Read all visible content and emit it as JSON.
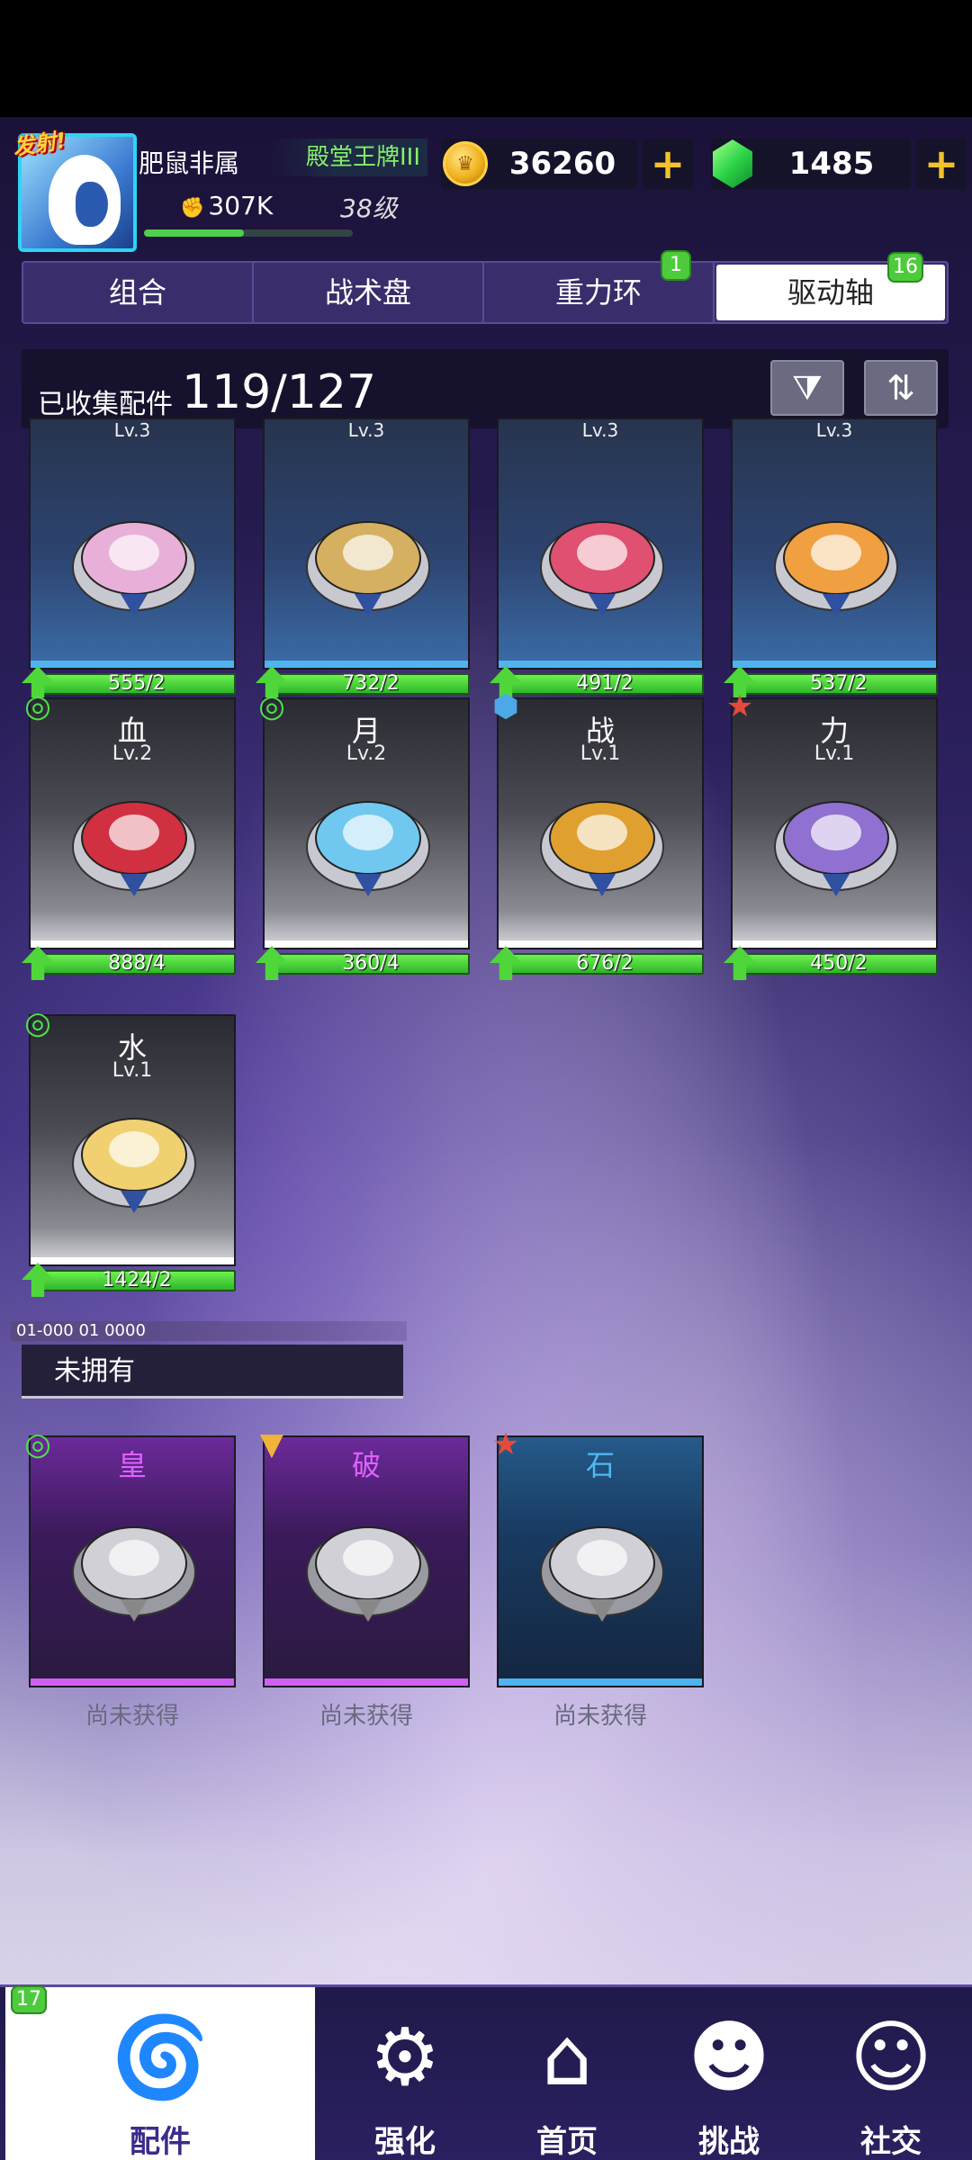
{
  "header": {
    "fire_badge": "发射!",
    "player_name": "肥鼠非属",
    "rank": "殿堂王牌III",
    "power": "307K",
    "level": "38级",
    "xp_fraction": 0.48,
    "gold": "36260",
    "gems": "1485"
  },
  "tabs": [
    {
      "label": "组合",
      "badge": ""
    },
    {
      "label": "战术盘",
      "badge": ""
    },
    {
      "label": "重力环",
      "badge": "1"
    },
    {
      "label": "驱动轴",
      "badge": "16"
    }
  ],
  "active_tab": "驱动轴",
  "collection": {
    "label": "已收集配件",
    "count": "119/127"
  },
  "owned_parts": [
    {
      "name": "",
      "level": "Lv.3",
      "progress": "555/2",
      "type_icon": "none",
      "color": "#e8b0d8"
    },
    {
      "name": "",
      "level": "Lv.3",
      "progress": "732/2",
      "type_icon": "none",
      "color": "#d4b060"
    },
    {
      "name": "",
      "level": "Lv.3",
      "progress": "491/2",
      "type_icon": "none",
      "color": "#e05070"
    },
    {
      "name": "",
      "level": "Lv.3",
      "progress": "537/2",
      "type_icon": "none",
      "color": "#f0a040"
    },
    {
      "name": "血",
      "level": "Lv.2",
      "progress": "888/4",
      "type_icon": "green-swirl-icon",
      "color": "#d03040"
    },
    {
      "name": "月",
      "level": "Lv.2",
      "progress": "360/4",
      "type_icon": "green-swirl-icon",
      "color": "#70c8f0"
    },
    {
      "name": "战",
      "level": "Lv.1",
      "progress": "676/2",
      "type_icon": "blue-hexagon-icon",
      "color": "#e0a030"
    },
    {
      "name": "力",
      "level": "Lv.1",
      "progress": "450/2",
      "type_icon": "red-star-icon",
      "color": "#9070d0"
    },
    {
      "name": "水",
      "level": "Lv.1",
      "progress": "1424/2",
      "type_icon": "green-swirl-icon",
      "color": "#f0d070"
    }
  ],
  "section": {
    "strip_text": "01-000 01 0000",
    "title": "未拥有"
  },
  "unowned_parts": [
    {
      "name": "皇",
      "status": "尚未获得",
      "type_icon": "green-swirl-icon"
    },
    {
      "name": "破",
      "status": "尚未获得",
      "type_icon": "gold-triangle-icon"
    },
    {
      "name": "石",
      "status": "尚未获得",
      "type_icon": "red-star-icon"
    }
  ],
  "nav": {
    "badge": "17",
    "items": [
      {
        "label": "配件"
      },
      {
        "label": "强化"
      },
      {
        "label": "首页"
      },
      {
        "label": "挑战"
      },
      {
        "label": "社交"
      }
    ]
  }
}
